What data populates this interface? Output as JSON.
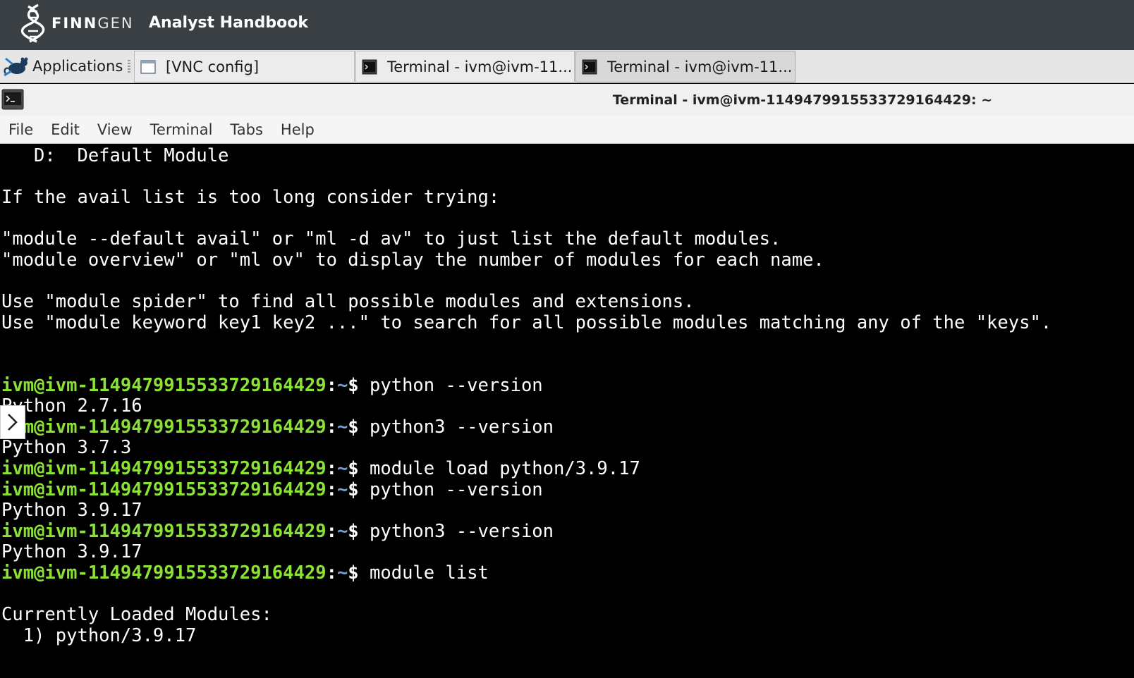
{
  "brand": {
    "word_bold": "FINN",
    "word_light": "GEN",
    "title": "Analyst Handbook"
  },
  "taskbar": {
    "apps_label": "Applications",
    "tasks": [
      {
        "label": "[VNC config]"
      },
      {
        "label": "Terminal - ivm@ivm-11..."
      },
      {
        "label": "Terminal - ivm@ivm-11..."
      }
    ]
  },
  "window": {
    "title": "Terminal - ivm@ivm-1149479915533729164429: ~"
  },
  "menu": [
    "File",
    "Edit",
    "View",
    "Terminal",
    "Tabs",
    "Help"
  ],
  "terminal": {
    "prompt_user": "ivm@ivm-1149479915533729164429",
    "prompt_sep": ":",
    "prompt_dir": "~",
    "prompt_end": "$ ",
    "lines": [
      {
        "text": "   D:  Default Module"
      },
      {
        "text": ""
      },
      {
        "text": "If the avail list is too long consider trying:"
      },
      {
        "text": ""
      },
      {
        "text": "\"module --default avail\" or \"ml -d av\" to just list the default modules."
      },
      {
        "text": "\"module overview\" or \"ml ov\" to display the number of modules for each name."
      },
      {
        "text": ""
      },
      {
        "text": "Use \"module spider\" to find all possible modules and extensions."
      },
      {
        "text": "Use \"module keyword key1 key2 ...\" to search for all possible modules matching any of the \"keys\"."
      },
      {
        "text": ""
      },
      {
        "text": ""
      },
      {
        "cmd": "python --version"
      },
      {
        "text": "Python 2.7.16"
      },
      {
        "cmd": "python3 --version"
      },
      {
        "text": "Python 3.7.3"
      },
      {
        "cmd": "module load python/3.9.17"
      },
      {
        "cmd": "python --version"
      },
      {
        "text": "Python 3.9.17"
      },
      {
        "cmd": "python3 --version"
      },
      {
        "text": "Python 3.9.17"
      },
      {
        "cmd": "module list"
      },
      {
        "text": ""
      },
      {
        "text": "Currently Loaded Modules:"
      },
      {
        "text": "  1) python/3.9.17"
      }
    ]
  },
  "colors": {
    "prompt_user": "#8ae234",
    "prompt_dir": "#729fcf",
    "brandbar": "#3a3f44"
  }
}
